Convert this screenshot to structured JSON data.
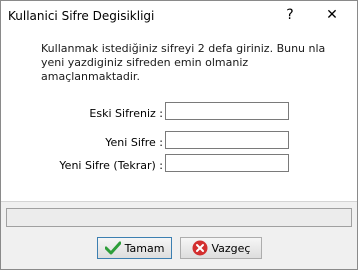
{
  "window": {
    "title": "Kullanici Sifre Degisikligi",
    "help_glyph": "?",
    "close_glyph": "✕"
  },
  "message": {
    "line1": "Kullanmak istediğiniz sifreyi 2 defa giriniz. Bunu nla",
    "line2": "yeni yazdiginiz sifreden emin olmaniz",
    "line3": "amaçlanmaktadir."
  },
  "form": {
    "old_password_label": "Eski Sifreniz :",
    "old_password_value": "",
    "new_password_label": "Yeni Sifre :",
    "new_password_value": "",
    "confirm_password_label": "Yeni Sifre (Tekrar) :",
    "confirm_password_value": ""
  },
  "status": {
    "text": ""
  },
  "buttons": {
    "ok_label": "Tamam",
    "cancel_label": "Vazgeç"
  },
  "icons": {
    "ok": "check-icon",
    "cancel": "cancel-icon",
    "ok_color": "#2e9e3a",
    "cancel_color": "#d32f2f"
  }
}
